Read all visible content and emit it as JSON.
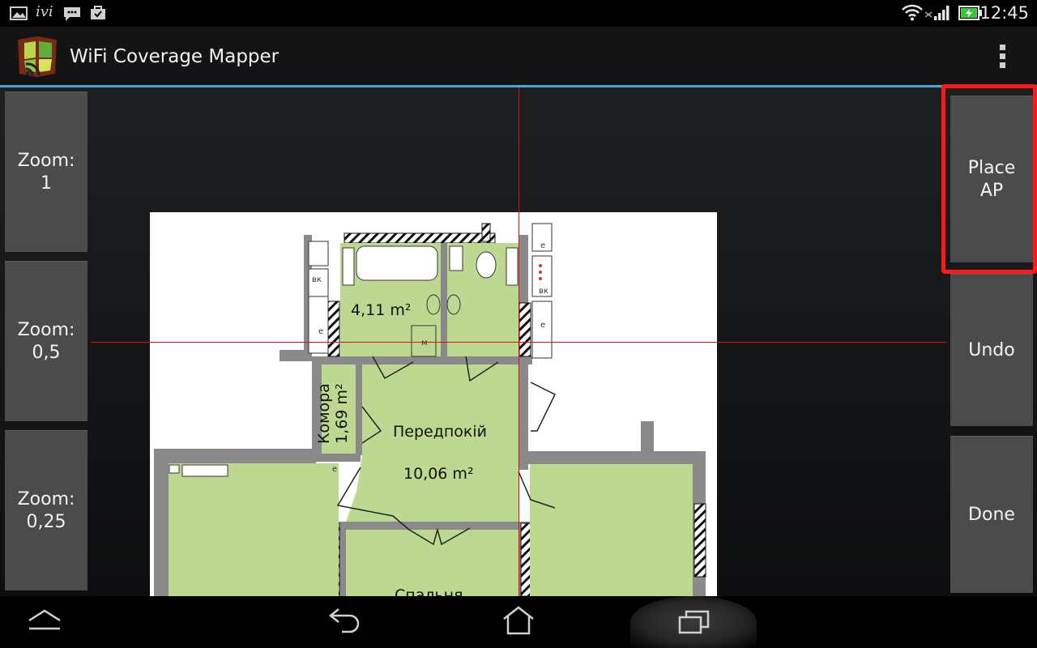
{
  "status_bar": {
    "clock": "12:45",
    "left_icons": [
      "gallery-icon",
      "ivi-icon",
      "message-icon",
      "store-icon"
    ],
    "ivi_label": "ivi",
    "right_icons": [
      "wifi-icon",
      "signal-icon",
      "battery-charging-icon"
    ]
  },
  "action_bar": {
    "title": "WiFi Coverage Mapper",
    "menu_icon": "overflow-menu-icon"
  },
  "left_buttons": [
    {
      "label": "Zoom:\n1"
    },
    {
      "label": "Zoom:\n0,5"
    },
    {
      "label": "Zoom:\n0,25"
    }
  ],
  "right_buttons": [
    {
      "label": "Place\nAP"
    },
    {
      "label": "Undo"
    },
    {
      "label": "Done"
    }
  ],
  "floorplan": {
    "rooms": [
      {
        "label": "4,11 m²"
      },
      {
        "label": "Комора\n1,69 m²"
      },
      {
        "label": "Передпокій"
      },
      {
        "label": "10,06 m²"
      },
      {
        "label": "Спальня"
      }
    ],
    "fixture_letters": [
      "вк",
      "е",
      "е",
      "е",
      "е",
      "м",
      "вк"
    ]
  },
  "nav_bar": {
    "icons": [
      "home-up-icon",
      "back-icon",
      "home-icon",
      "recent-apps-icon"
    ]
  },
  "colors": {
    "accent": "#4aa6d6",
    "highlight": "#ff1a1a",
    "crosshair": "#e01010",
    "room_fill": "#bcd891",
    "wall": "#8a8a8a"
  }
}
